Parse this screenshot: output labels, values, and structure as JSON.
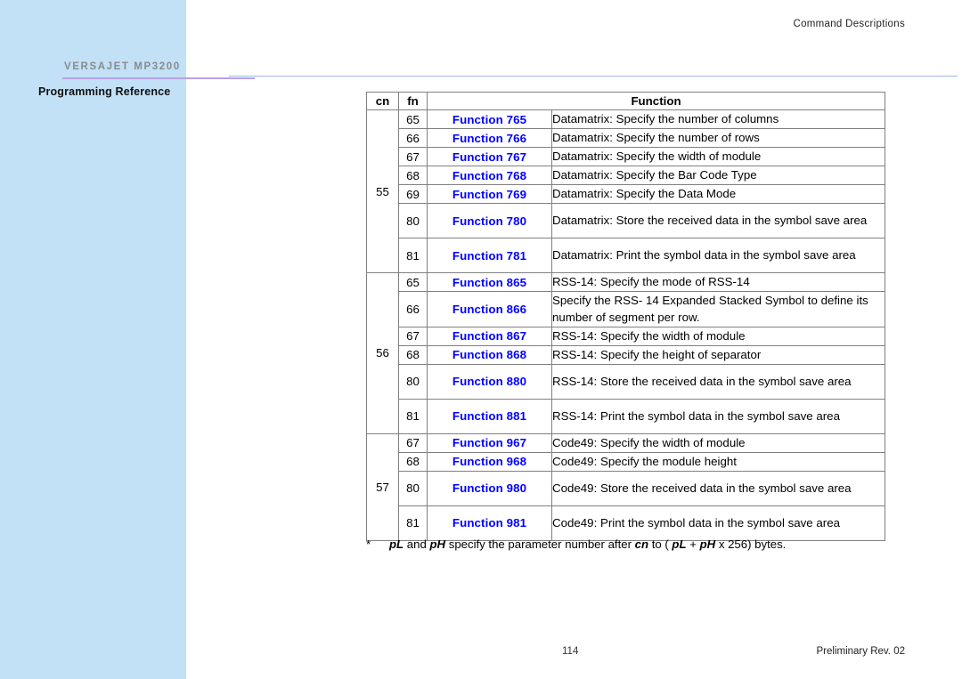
{
  "document": {
    "running_head": "Command  Descriptions",
    "brand": "VERSAJET MP3200",
    "subbrand": "Programming Reference",
    "page_number": "114",
    "revision_note": "Preliminary Rev. 02"
  },
  "colors": {
    "sidebar": "#c2e1f7",
    "rule_purple": "#b9a0e8",
    "rule_blue": "#9bb9e8",
    "function_link": "#0000ff",
    "brand_text": "#8a8a8a",
    "table_border": "#808080"
  },
  "table": {
    "headers": {
      "cn": "cn",
      "fn": "fn",
      "function": "Function"
    },
    "groups": [
      {
        "cn": "55",
        "rows": [
          {
            "fn": "65",
            "name": "Function 765",
            "desc": "Datamatrix: Specify the number of columns",
            "lines": 1
          },
          {
            "fn": "66",
            "name": "Function 766",
            "desc": "Datamatrix: Specify the number of rows",
            "lines": 1
          },
          {
            "fn": "67",
            "name": "Function 767",
            "desc": "Datamatrix: Specify the width of module",
            "lines": 1
          },
          {
            "fn": "68",
            "name": "Function 768",
            "desc": "Datamatrix: Specify the Bar Code Type",
            "lines": 1
          },
          {
            "fn": "69",
            "name": "Function 769",
            "desc": "Datamatrix: Specify the Data Mode",
            "lines": 1
          },
          {
            "fn": "80",
            "name": "Function 780",
            "desc": "Datamatrix: Store the received data in the symbol save area",
            "lines": 2
          },
          {
            "fn": "81",
            "name": "Function 781",
            "desc": "Datamatrix: Print the symbol data in the symbol save area",
            "lines": 2
          }
        ]
      },
      {
        "cn": "56",
        "rows": [
          {
            "fn": "65",
            "name": "Function 865",
            "desc": "RSS-14: Specify the mode of RSS-14",
            "lines": 1
          },
          {
            "fn": "66",
            "name": "Function 866",
            "desc": "Specify the RSS- 14 Expanded Stacked Symbol to define its number of segment per row.",
            "lines": 2
          },
          {
            "fn": "67",
            "name": "Function 867",
            "desc": "RSS-14: Specify the width of module",
            "lines": 1
          },
          {
            "fn": "68",
            "name": "Function 868",
            "desc": "RSS-14: Specify the height of separator",
            "lines": 1
          },
          {
            "fn": "80",
            "name": "Function 880",
            "desc": "RSS-14: Store the received data in the symbol save area",
            "lines": 2
          },
          {
            "fn": "81",
            "name": "Function 881",
            "desc": "RSS-14: Print the symbol data in the symbol save area",
            "lines": 2
          }
        ]
      },
      {
        "cn": "57",
        "rows": [
          {
            "fn": "67",
            "name": "Function 967",
            "desc": "Code49: Specify the width of module",
            "lines": 1
          },
          {
            "fn": "68",
            "name": "Function 968",
            "desc": "Code49: Specify the module height",
            "lines": 1
          },
          {
            "fn": "80",
            "name": "Function 980",
            "desc": "Code49: Store the received data in the symbol save area",
            "lines": 2
          },
          {
            "fn": "81",
            "name": "Function 981",
            "desc": "Code49: Print the symbol data in the symbol save area",
            "lines": 2
          }
        ]
      }
    ]
  },
  "footnote": {
    "star": "*",
    "part1": "pL",
    "part2": " and ",
    "part3": "pH",
    "part4": " specify the parameter number after ",
    "part5": "cn",
    "part6": " to ( ",
    "part7": "pL",
    "part8": " + ",
    "part9": "pH",
    "part10": " x 256) bytes.",
    "full_text": "* pL and pH specify the parameter number after cn to ( pL + pH x 256) bytes."
  }
}
